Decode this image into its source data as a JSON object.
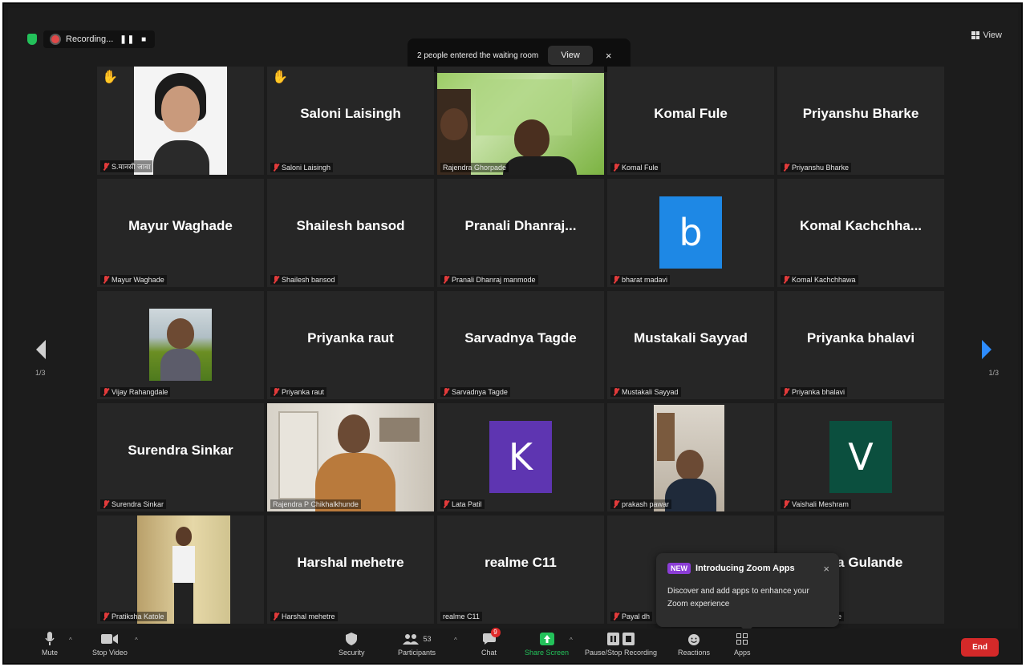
{
  "topbar": {
    "recording_label": "Recording...",
    "view_label": "View"
  },
  "waiting_room": {
    "message": "2 people entered the waiting room",
    "view_button": "View",
    "close": "×"
  },
  "pagination": {
    "left": "1/3",
    "right": "1/3"
  },
  "tiles": [
    {
      "big": "",
      "name": "S.मानसी जावा",
      "raised_hand": true,
      "kind": "photo"
    },
    {
      "big": "Saloni Laisingh",
      "name": "Saloni Laisingh",
      "raised_hand": true,
      "kind": "text"
    },
    {
      "big": "",
      "name": "Rajendra Ghorpade",
      "kind": "video"
    },
    {
      "big": "Komal Fule",
      "name": "Komal Fule",
      "kind": "text"
    },
    {
      "big": "Priyanshu Bharke",
      "name": "Priyanshu Bharke",
      "kind": "text"
    },
    {
      "big": "Mayur Waghade",
      "name": "Mayur Waghade",
      "kind": "text"
    },
    {
      "big": "Shailesh bansod",
      "name": "Shailesh bansod",
      "kind": "text"
    },
    {
      "big": "Pranali  Dhanraj...",
      "name": "Pranali Dhanraj manmode",
      "kind": "text"
    },
    {
      "big": "",
      "name": "bharat madavi",
      "kind": "avatar",
      "letter": "b",
      "color": "#1e88e5"
    },
    {
      "big": "Komal  Kachchha...",
      "name": "Komal Kachchhawa",
      "kind": "text"
    },
    {
      "big": "",
      "name": "Vijay Rahangdale",
      "kind": "photo"
    },
    {
      "big": "Priyanka raut",
      "name": "Priyanka raut",
      "kind": "text"
    },
    {
      "big": "Sarvadnya Tagde",
      "name": "Sarvadnya Tagde",
      "kind": "text"
    },
    {
      "big": "Mustakali Sayyad",
      "name": "Mustakali Sayyad",
      "kind": "text"
    },
    {
      "big": "Priyanka bhalavi",
      "name": "Priyanka bhalavi",
      "kind": "text"
    },
    {
      "big": "Surendra Sinkar",
      "name": "Surendra Sinkar",
      "kind": "text"
    },
    {
      "big": "",
      "name": "Rajendra P Chikhalkhunde",
      "kind": "video",
      "active": true
    },
    {
      "big": "",
      "name": "Lata Patil",
      "kind": "avatar",
      "letter": "K",
      "color": "#5e35b1"
    },
    {
      "big": "",
      "name": "prakash pawar",
      "kind": "photo"
    },
    {
      "big": "",
      "name": "Vaishali Meshram",
      "kind": "avatar",
      "letter": "V",
      "color": "#0b4f3e"
    },
    {
      "big": "",
      "name": "Pratiksha Katole",
      "kind": "photo"
    },
    {
      "big": "Harshal mehetre",
      "name": "Harshal mehetre",
      "kind": "text"
    },
    {
      "big": "realme C11",
      "name": "realme C11",
      "kind": "text",
      "no_mic": true
    },
    {
      "big": "",
      "name": "Payal dh",
      "kind": "text"
    },
    {
      "big": "ika Gulande",
      "name": "nde",
      "kind": "text"
    }
  ],
  "toast": {
    "badge": "NEW",
    "title": "Introducing Zoom Apps",
    "body": "Discover and add apps to enhance your Zoom experience",
    "close": "×"
  },
  "toolbar": {
    "mute": "Mute",
    "stop_video": "Stop Video",
    "security": "Security",
    "participants": "Participants",
    "participants_count": "53",
    "chat": "Chat",
    "chat_badge": "9",
    "share_screen": "Share Screen",
    "pause_recording": "Pause/Stop Recording",
    "reactions": "Reactions",
    "apps": "Apps",
    "end": "End"
  },
  "colors": {
    "accent_share": "#23c15a",
    "active_speaker": "#c8e04a",
    "end_button": "#d42929"
  }
}
